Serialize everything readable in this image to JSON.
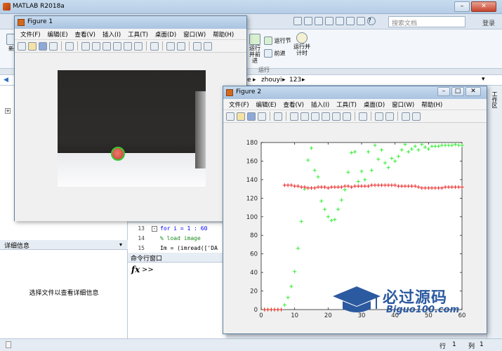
{
  "app": {
    "title": "MATLAB R2018a",
    "search_placeholder": "搜索文档",
    "login_label": "登录"
  },
  "ribbon": {
    "new_label": "新",
    "run_section_label": "运行并前进",
    "run_section_sub": "运行节",
    "advance_label": "前进",
    "run_time_label": "运行并计时",
    "group_label": "运行"
  },
  "address": {
    "path_parts": [
      "e",
      "zhouyi",
      "123"
    ]
  },
  "left_panel": {
    "detail_header": "详细信息",
    "detail_text": "选择文件以查看详细信息"
  },
  "editor": {
    "lines": [
      {
        "num": "13",
        "text": "for i = 1 : 60"
      },
      {
        "num": "14",
        "text": "% load image"
      },
      {
        "num": "15",
        "text": "Im = (imread(['DA"
      }
    ]
  },
  "command_window": {
    "header": "命令行窗口",
    "fx": "fx",
    "prompt": ">>"
  },
  "status": {
    "row_label": "行",
    "row_value": "1",
    "col_label": "列",
    "col_value": "1"
  },
  "figure1": {
    "title": "Figure 1",
    "menu": [
      "文件(F)",
      "编辑(E)",
      "查看(V)",
      "插入(I)",
      "工具(T)",
      "桌面(D)",
      "窗口(W)",
      "帮助(H)"
    ]
  },
  "figure2": {
    "title": "Figure 2",
    "menu": [
      "文件(F)",
      "编辑(E)",
      "查看(V)",
      "插入(I)",
      "工具(T)",
      "桌面(D)",
      "窗口(W)",
      "帮助(H)"
    ]
  },
  "watermark": {
    "main": "必过源码",
    "sub": "Biguo100.com"
  },
  "colors": {
    "green_series": "#33ee33",
    "red_series": "#ee2222"
  },
  "chart_data": {
    "type": "scatter",
    "xlim": [
      0,
      60
    ],
    "ylim": [
      0,
      180
    ],
    "xticks": [
      0,
      10,
      20,
      30,
      40,
      50,
      60
    ],
    "yticks": [
      0,
      20,
      40,
      60,
      80,
      100,
      120,
      140,
      160,
      180
    ],
    "grid": false,
    "series": [
      {
        "marker": "+",
        "color": "#33ee33",
        "points": [
          [
            1,
            0
          ],
          [
            2,
            0
          ],
          [
            3,
            0
          ],
          [
            4,
            0
          ],
          [
            5,
            0
          ],
          [
            6,
            0
          ],
          [
            7,
            5
          ],
          [
            8,
            13
          ],
          [
            9,
            25
          ],
          [
            10,
            41
          ],
          [
            11,
            66
          ],
          [
            12,
            95
          ],
          [
            13,
            130
          ],
          [
            14,
            161
          ],
          [
            15,
            174
          ],
          [
            16,
            150
          ],
          [
            17,
            143
          ],
          [
            18,
            117
          ],
          [
            19,
            108
          ],
          [
            20,
            100
          ],
          [
            21,
            96
          ],
          [
            22,
            97
          ],
          [
            23,
            108
          ],
          [
            24,
            118
          ],
          [
            25,
            129
          ],
          [
            26,
            148
          ],
          [
            27,
            169
          ],
          [
            28,
            170
          ],
          [
            29,
            138
          ],
          [
            30,
            149
          ],
          [
            31,
            140
          ],
          [
            32,
            170
          ],
          [
            33,
            150
          ],
          [
            34,
            177
          ],
          [
            35,
            162
          ],
          [
            36,
            172
          ],
          [
            37,
            158
          ],
          [
            38,
            153
          ],
          [
            39,
            163
          ],
          [
            40,
            160
          ],
          [
            41,
            165
          ],
          [
            42,
            172
          ],
          [
            43,
            178
          ],
          [
            44,
            170
          ],
          [
            45,
            173
          ],
          [
            46,
            176
          ],
          [
            47,
            172
          ],
          [
            48,
            178
          ],
          [
            49,
            175
          ],
          [
            50,
            173
          ],
          [
            51,
            176
          ],
          [
            52,
            176
          ],
          [
            53,
            176
          ],
          [
            54,
            177
          ],
          [
            55,
            177
          ],
          [
            56,
            177
          ],
          [
            57,
            177
          ],
          [
            58,
            178
          ],
          [
            59,
            177
          ],
          [
            60,
            177
          ]
        ]
      },
      {
        "marker": "+",
        "color": "#ee2222",
        "points": [
          [
            1,
            0
          ],
          [
            2,
            0
          ],
          [
            3,
            0
          ],
          [
            4,
            0
          ],
          [
            5,
            0
          ],
          [
            6,
            0
          ],
          [
            7,
            134
          ],
          [
            8,
            134
          ],
          [
            9,
            134
          ],
          [
            10,
            133
          ],
          [
            11,
            133
          ],
          [
            12,
            132
          ],
          [
            13,
            132
          ],
          [
            14,
            131
          ],
          [
            15,
            131
          ],
          [
            16,
            131
          ],
          [
            17,
            132
          ],
          [
            18,
            132
          ],
          [
            19,
            132
          ],
          [
            20,
            131
          ],
          [
            21,
            132
          ],
          [
            22,
            132
          ],
          [
            23,
            132
          ],
          [
            24,
            132
          ],
          [
            25,
            133
          ],
          [
            26,
            133
          ],
          [
            27,
            132
          ],
          [
            28,
            133
          ],
          [
            29,
            133
          ],
          [
            30,
            133
          ],
          [
            31,
            133
          ],
          [
            32,
            133
          ],
          [
            33,
            134
          ],
          [
            34,
            134
          ],
          [
            35,
            134
          ],
          [
            36,
            134
          ],
          [
            37,
            134
          ],
          [
            38,
            134
          ],
          [
            39,
            134
          ],
          [
            40,
            134
          ],
          [
            41,
            133
          ],
          [
            42,
            133
          ],
          [
            43,
            133
          ],
          [
            44,
            133
          ],
          [
            45,
            133
          ],
          [
            46,
            133
          ],
          [
            47,
            132
          ],
          [
            48,
            131
          ],
          [
            49,
            131
          ],
          [
            50,
            131
          ],
          [
            51,
            131
          ],
          [
            52,
            131
          ],
          [
            53,
            131
          ],
          [
            54,
            131
          ],
          [
            55,
            132
          ],
          [
            56,
            132
          ],
          [
            57,
            132
          ],
          [
            58,
            132
          ],
          [
            59,
            132
          ],
          [
            60,
            132
          ]
        ]
      }
    ]
  }
}
